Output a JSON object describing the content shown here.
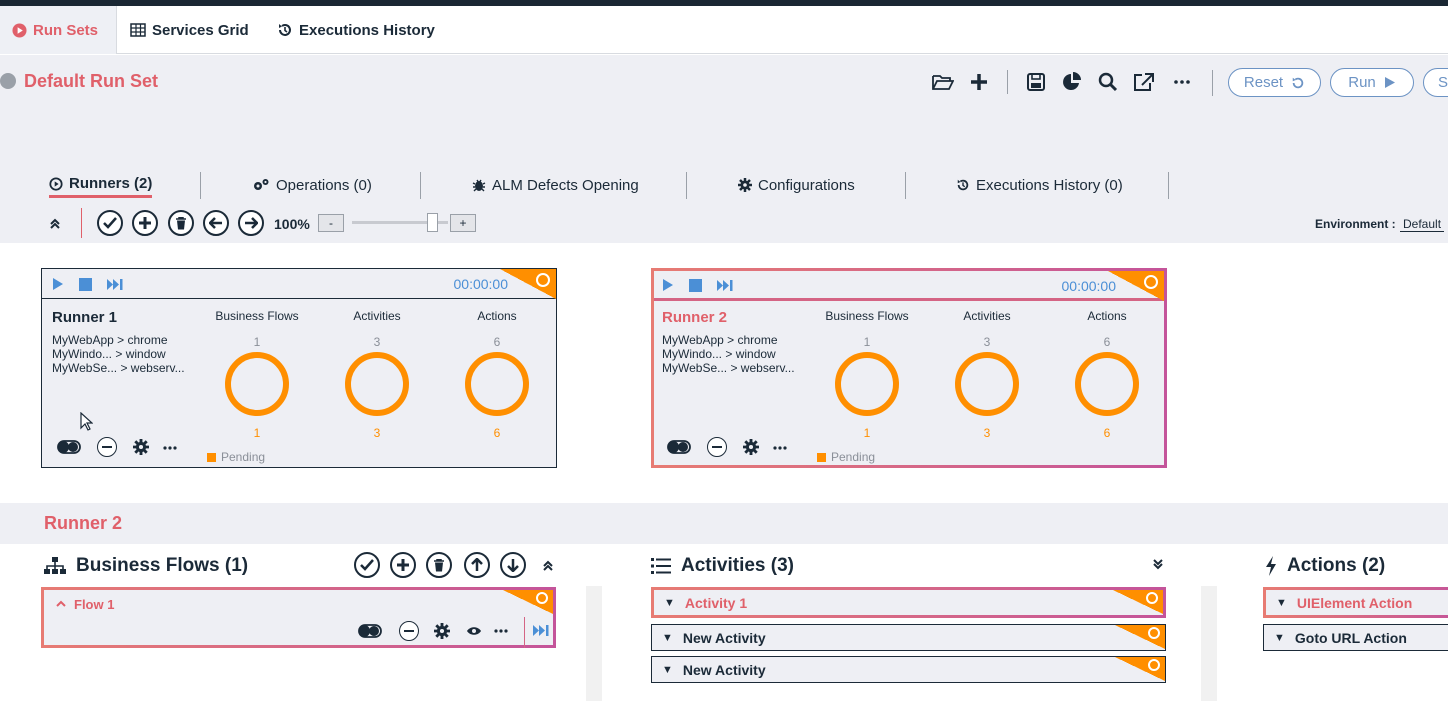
{
  "tabs": [
    {
      "label": "Run Sets",
      "icon": "play-circle-icon"
    },
    {
      "label": "Services Grid",
      "icon": "grid-icon"
    },
    {
      "label": "Executions History",
      "icon": "history-icon"
    }
  ],
  "runset": {
    "title": "Default Run Set",
    "reset_label": "Reset",
    "run_label": "Run",
    "stop_label": "S"
  },
  "subtabs": [
    {
      "label": "Runners (2)",
      "icon": "play-circle-icon"
    },
    {
      "label": "Operations (0)",
      "icon": "gears-icon"
    },
    {
      "label": "ALM Defects Opening",
      "icon": "bug-icon"
    },
    {
      "label": "Configurations",
      "icon": "gear-icon"
    },
    {
      "label": "Executions History (0)",
      "icon": "history-icon"
    }
  ],
  "toolbar": {
    "zoom": "100%",
    "zoom_minus": "-",
    "zoom_plus": "+",
    "zoom_level": 0.88,
    "environment_label": "Environment :",
    "environment_value": "Default"
  },
  "runners": [
    {
      "name": "Runner 1",
      "timer": "00:00:00",
      "apps": [
        "MyWebApp > chrome",
        "MyWindo... > window",
        "MyWebSe... > webserv..."
      ],
      "stats": [
        {
          "label": "Business Flows",
          "top": "1",
          "bottom": "1"
        },
        {
          "label": "Activities",
          "top": "3",
          "bottom": "3"
        },
        {
          "label": "Actions",
          "top": "6",
          "bottom": "6"
        }
      ],
      "status": "Pending"
    },
    {
      "name": "Runner 2",
      "timer": "00:00:00",
      "apps": [
        "MyWebApp > chrome",
        "MyWindo... > window",
        "MyWebSe... > webserv..."
      ],
      "stats": [
        {
          "label": "Business Flows",
          "top": "1",
          "bottom": "1"
        },
        {
          "label": "Activities",
          "top": "3",
          "bottom": "3"
        },
        {
          "label": "Actions",
          "top": "6",
          "bottom": "6"
        }
      ],
      "status": "Pending"
    }
  ],
  "selected_runner": "Runner 2",
  "business_flows": {
    "title": "Business Flows (1)",
    "items": [
      "Flow 1"
    ]
  },
  "activities": {
    "title": "Activities (3)",
    "items": [
      "Activity 1",
      "New Activity",
      "New Activity"
    ]
  },
  "actions": {
    "title": "Actions (2)",
    "items": [
      "UIElement Action",
      "Goto URL Action"
    ]
  },
  "colors": {
    "accent": "#e0606a",
    "orange": "#ff8f00",
    "blue": "#4b8fd6",
    "pill": "#6c93c4"
  }
}
